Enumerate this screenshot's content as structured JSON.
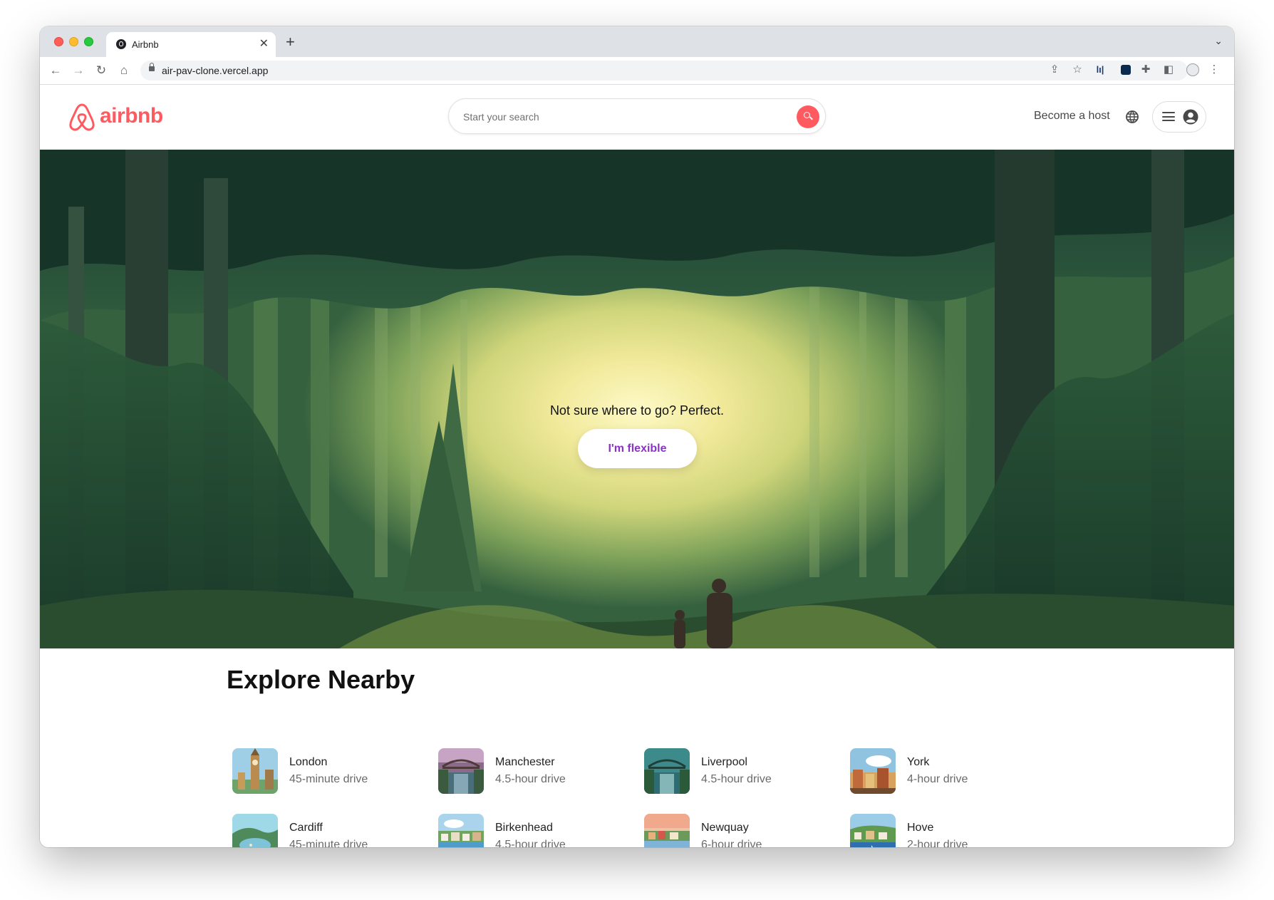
{
  "browser": {
    "tab_title": "Airbnb",
    "url": "air-pav-clone.vercel.app"
  },
  "header": {
    "logo_text": "airbnb",
    "search_placeholder": "Start your search",
    "host_link": "Become a host",
    "brand_color": "#ff5a5f"
  },
  "hero": {
    "tagline": "Not sure where to go? Perfect.",
    "button_label": "I'm flexible",
    "button_color": "#8a33c9"
  },
  "explore": {
    "title": "Explore Nearby",
    "items": [
      {
        "name": "London",
        "distance": "45-minute drive",
        "icon": "big-ben-thumbnail"
      },
      {
        "name": "Manchester",
        "distance": "4.5-hour drive",
        "icon": "bridge-thumbnail"
      },
      {
        "name": "Liverpool",
        "distance": "4.5-hour drive",
        "icon": "bridge-thumbnail"
      },
      {
        "name": "York",
        "distance": "4-hour drive",
        "icon": "town-thumbnail"
      },
      {
        "name": "Cardiff",
        "distance": "45-minute drive",
        "icon": "lake-thumbnail"
      },
      {
        "name": "Birkenhead",
        "distance": "4.5-hour drive",
        "icon": "harbour-thumbnail"
      },
      {
        "name": "Newquay",
        "distance": "6-hour drive",
        "icon": "coast-thumbnail"
      },
      {
        "name": "Hove",
        "distance": "2-hour drive",
        "icon": "seaside-thumbnail"
      }
    ]
  }
}
